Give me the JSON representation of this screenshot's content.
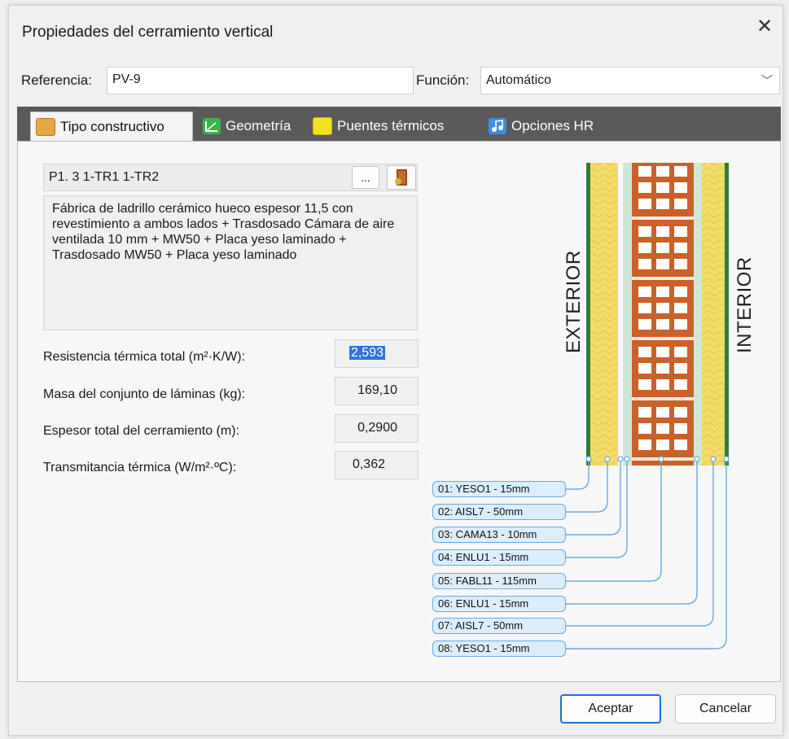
{
  "dialog": {
    "title": "Propiedades del cerramiento vertical",
    "close_glyph": "✕"
  },
  "form": {
    "referencia_label": "Referencia:",
    "referencia_value": "PV-9",
    "funcion_label": "Función:",
    "funcion_value": "Automático"
  },
  "tabs": [
    {
      "label": "Tipo constructivo",
      "icon": "folder-icon",
      "color": "#e8a646"
    },
    {
      "label": "Geometría",
      "icon": "geometry-icon",
      "color": "#3bb34a"
    },
    {
      "label": "Puentes térmicos",
      "icon": "thermal-bridge-icon",
      "color": "#f2e21e"
    },
    {
      "label": "Opciones HR",
      "icon": "hr-options-icon",
      "color": "#3b8fe0"
    }
  ],
  "construction": {
    "code": "P1. 3 1-TR1 1-TR2",
    "browse_label": "...",
    "description": "Fábrica de ladrillo cerámico hueco espesor 11,5 con revestimiento a ambos lados + Trasdosado Cámara de aire ventilada 10 mm + MW50 + Placa  yeso laminado + Trasdosado MW50 + Placa  yeso laminado"
  },
  "properties": [
    {
      "label": "Resistencia térmica total (m²·K/W):",
      "value": "2,593"
    },
    {
      "label": "Masa del conjunto de láminas (kg):",
      "value": "169,10"
    },
    {
      "label": "Espesor total del cerramiento (m):",
      "value": "0,2900"
    },
    {
      "label": "Transmitancia térmica (W/m²·ºC):",
      "value": "0,362"
    }
  ],
  "section": {
    "exterior_label": "EXTERIOR",
    "interior_label": "INTERIOR",
    "layers": [
      "01: YESO1 - 15mm",
      "02: AISL7 - 50mm",
      "03: CAMA13 - 10mm",
      "04: ENLU1 - 15mm",
      "05: FABL11 - 115mm",
      "06: ENLU1 - 15mm",
      "07: AISL7 - 50mm",
      "08: YESO1 - 15mm"
    ]
  },
  "buttons": {
    "accept": "Aceptar",
    "cancel": "Cancelar"
  }
}
